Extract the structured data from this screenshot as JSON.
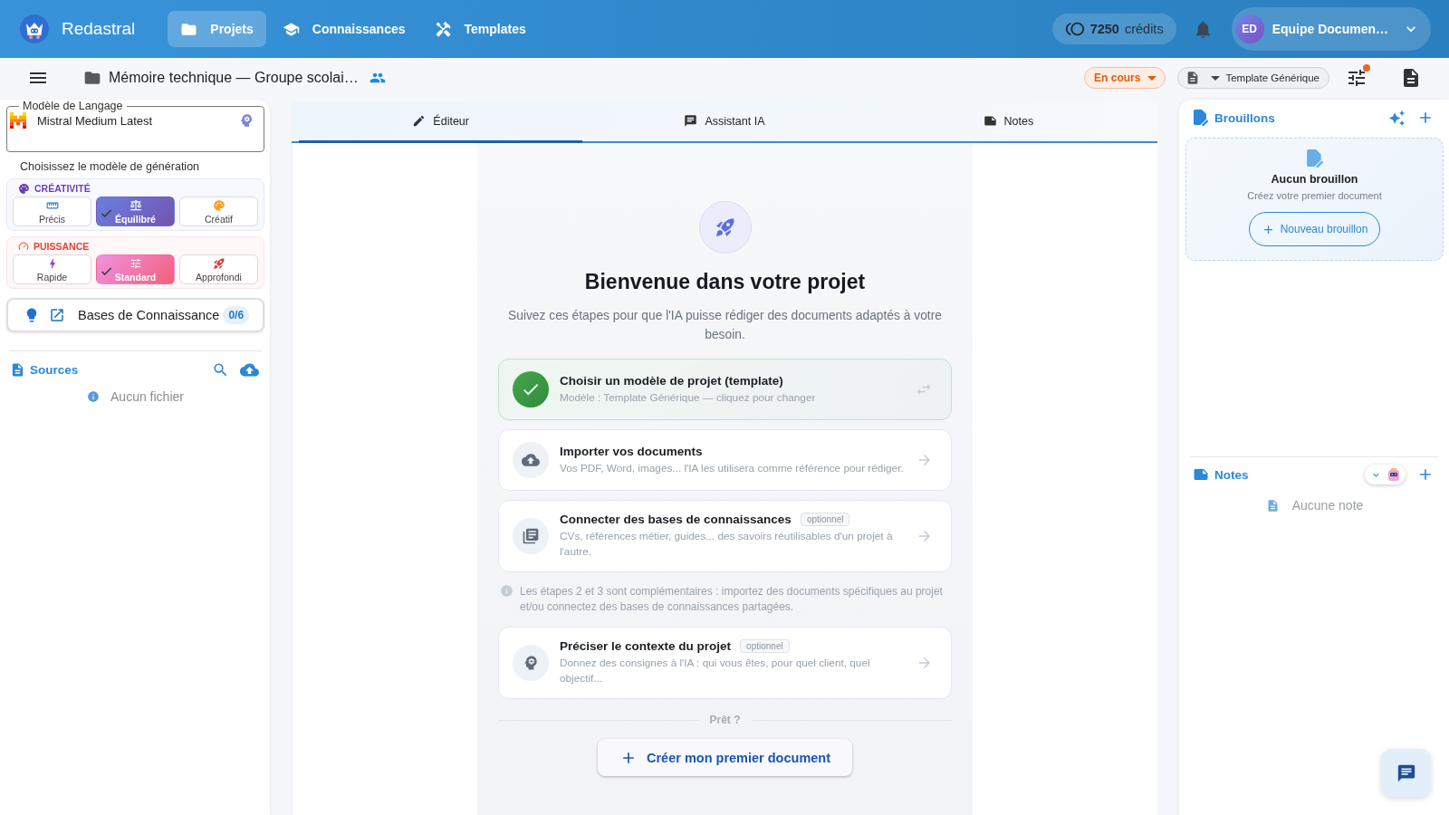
{
  "app_bar": {
    "brand": "Redastral",
    "nav": [
      {
        "label": "Projets",
        "selected": true
      },
      {
        "label": "Connaissances",
        "selected": false
      },
      {
        "label": "Templates",
        "selected": false
      }
    ],
    "credits": {
      "amount": "7250",
      "unit": "crédits"
    },
    "user": {
      "initials": "ED",
      "name": "Equipe Documen…"
    }
  },
  "project_bar": {
    "title": "Mémoire technique — Groupe scolai…",
    "status": "En cours",
    "template": "Template Générique",
    "settings_alert": true
  },
  "left_panel": {
    "model_field": {
      "label": "Modèle de Langage",
      "value": "Mistral Medium Latest"
    },
    "hint": "Choisissez le modèle de génération",
    "option_groups": [
      {
        "kind": "creativity",
        "title": "CRÉATIVITÉ",
        "options": [
          {
            "label": "Précis",
            "selected": false
          },
          {
            "label": "Équilibré",
            "selected": true
          },
          {
            "label": "Créatif",
            "selected": false
          }
        ]
      },
      {
        "kind": "power",
        "title": "PUISSANCE",
        "options": [
          {
            "label": "Rapide",
            "selected": false
          },
          {
            "label": "Standard",
            "selected": true
          },
          {
            "label": "Approfondi",
            "selected": false
          }
        ]
      }
    ],
    "knowledge_button": {
      "label": "Bases de Connaissance",
      "count": "0/6"
    },
    "sources": {
      "title": "Sources",
      "empty": "Aucun fichier"
    }
  },
  "editor": {
    "tabs": [
      {
        "label": "Éditeur",
        "selected": true
      },
      {
        "label": "Assistant IA",
        "selected": false
      },
      {
        "label": "Notes",
        "selected": false
      }
    ],
    "welcome": {
      "title": "Bienvenue dans votre projet",
      "subtitle": "Suivez ces étapes pour que l'IA puisse rédiger des documents adaptés à votre besoin.",
      "items": [
        {
          "kind": "step",
          "title": "Choisir un modèle de projet (template)",
          "description": "Modèle : Template Générique — cliquez pour changer",
          "done": true
        },
        {
          "kind": "step",
          "title": "Importer vos documents",
          "description": "Vos PDF, Word, images... l'IA les utilisera comme référence pour rédiger.",
          "done": false
        },
        {
          "kind": "step",
          "title": "Connecter des bases de connaissances",
          "badge": "optionnel",
          "description": "CVs, références métier, guides... des savoirs réutilisables d'un projet à l'autre.",
          "done": false
        },
        {
          "kind": "note",
          "text": "Les étapes 2 et 3 sont complémentaires : importez des documents spécifiques au projet et/ou connectez des bases de connaissances partagées."
        },
        {
          "kind": "step",
          "title": "Préciser le contexte du projet",
          "badge": "optionnel",
          "description": "Donnez des consignes à l'IA : qui vous êtes, pour quel client, quel objectif...",
          "done": false
        }
      ],
      "separator": "Prêt ?",
      "cta": "Créer mon premier document"
    }
  },
  "right_panel": {
    "drafts": {
      "title": "Brouillons",
      "empty_title": "Aucun brouillon",
      "empty_text": "Créez votre premier document",
      "new_button": "Nouveau brouillon"
    },
    "notes": {
      "title": "Notes",
      "empty": "Aucune note"
    }
  }
}
